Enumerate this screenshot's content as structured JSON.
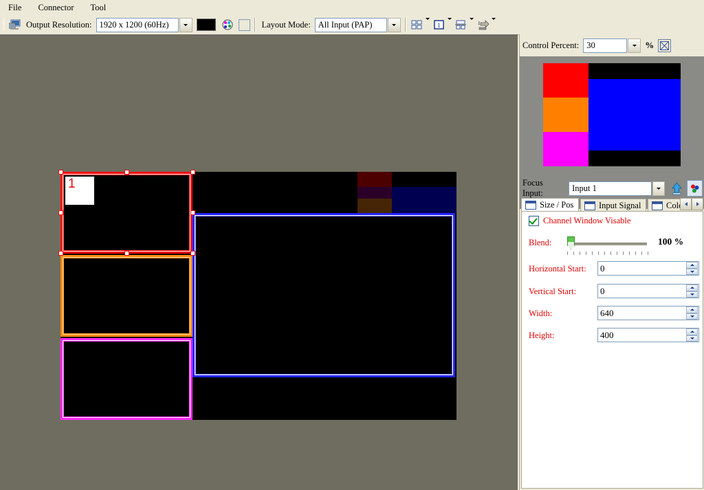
{
  "menu": {
    "items": [
      {
        "label": "File",
        "name": "menu-file"
      },
      {
        "label": "Connector",
        "name": "menu-connector"
      },
      {
        "label": "Tool",
        "name": "menu-tool"
      }
    ]
  },
  "toolbar": {
    "device_icon": "monitor-icon",
    "output_resolution_label": "Output Resolution:",
    "output_resolution_value": "1920 x 1200 (60Hz)",
    "color_swatch": "#000000",
    "palette_icon": "color-palette-icon",
    "blank_button_icon": "empty-square-icon",
    "layout_mode_label": "Layout Mode:",
    "layout_mode_value": "All Input (PAP)",
    "grid_icon": "four-pane-grid-icon",
    "single_icon": "single-pane-icon",
    "split_icon": "split-pane-icon",
    "input_icon": "input-source-icon"
  },
  "canvas": {
    "background_color": "#6f6d5f",
    "screen_color": "#000000",
    "windows": [
      {
        "name": "window-1-red",
        "label": "1",
        "color": "#fe0000",
        "selected": true
      },
      {
        "name": "window-2-orange",
        "label": "",
        "color": "#ff8c12",
        "selected": false
      },
      {
        "name": "window-3-magenta",
        "label": "",
        "color": "#ff28ff",
        "selected": false
      },
      {
        "name": "window-4-blue",
        "label": "",
        "color": "#2323ff",
        "selected": false
      }
    ],
    "dim_bars": [
      {
        "color": "#4d0000"
      },
      {
        "color": "#452505"
      },
      {
        "color": "#4b0040"
      },
      {
        "color": "#000050"
      }
    ]
  },
  "right_panel": {
    "control_percent_label": "Control Percent:",
    "control_percent_value": "30",
    "percent_sign": "%",
    "cross_button_icon": "crossed-box-icon",
    "preview": {
      "blocks": [
        {
          "name": "preview-block-red",
          "color": "#ff0000"
        },
        {
          "name": "preview-block-orange",
          "color": "#ff8000"
        },
        {
          "name": "preview-block-magenta",
          "color": "#ff00ff"
        },
        {
          "name": "preview-block-blue",
          "color": "#0000ff"
        }
      ]
    },
    "focus_input_label": "Focus Input:",
    "focus_input_value": "Input 1",
    "upload_icon": "blue-up-arrow-icon",
    "rgb_icon": "rgb-balls-icon",
    "tabs": [
      {
        "label": "Size / Pos",
        "name": "tab-size-pos",
        "active": true
      },
      {
        "label": "Input Signal",
        "name": "tab-input-signal",
        "active": false
      },
      {
        "label": "Color S",
        "name": "tab-color-setting",
        "active": false
      }
    ],
    "tab_scroll_left": "left-arrow-icon",
    "tab_scroll_right": "right-arrow-icon",
    "size_pos": {
      "visible_checkbox_label": "Channel Window Visable",
      "visible_checked": true,
      "blend_label": "Blend:",
      "blend_value": "100 %",
      "fields": [
        {
          "label": "Horizontal Start:",
          "value": "0",
          "name": "horizontal-start"
        },
        {
          "label": "Vertical Start:",
          "value": "0",
          "name": "vertical-start"
        },
        {
          "label": "Width:",
          "value": "640",
          "name": "width"
        },
        {
          "label": "Height:",
          "value": "400",
          "name": "height"
        }
      ]
    }
  }
}
